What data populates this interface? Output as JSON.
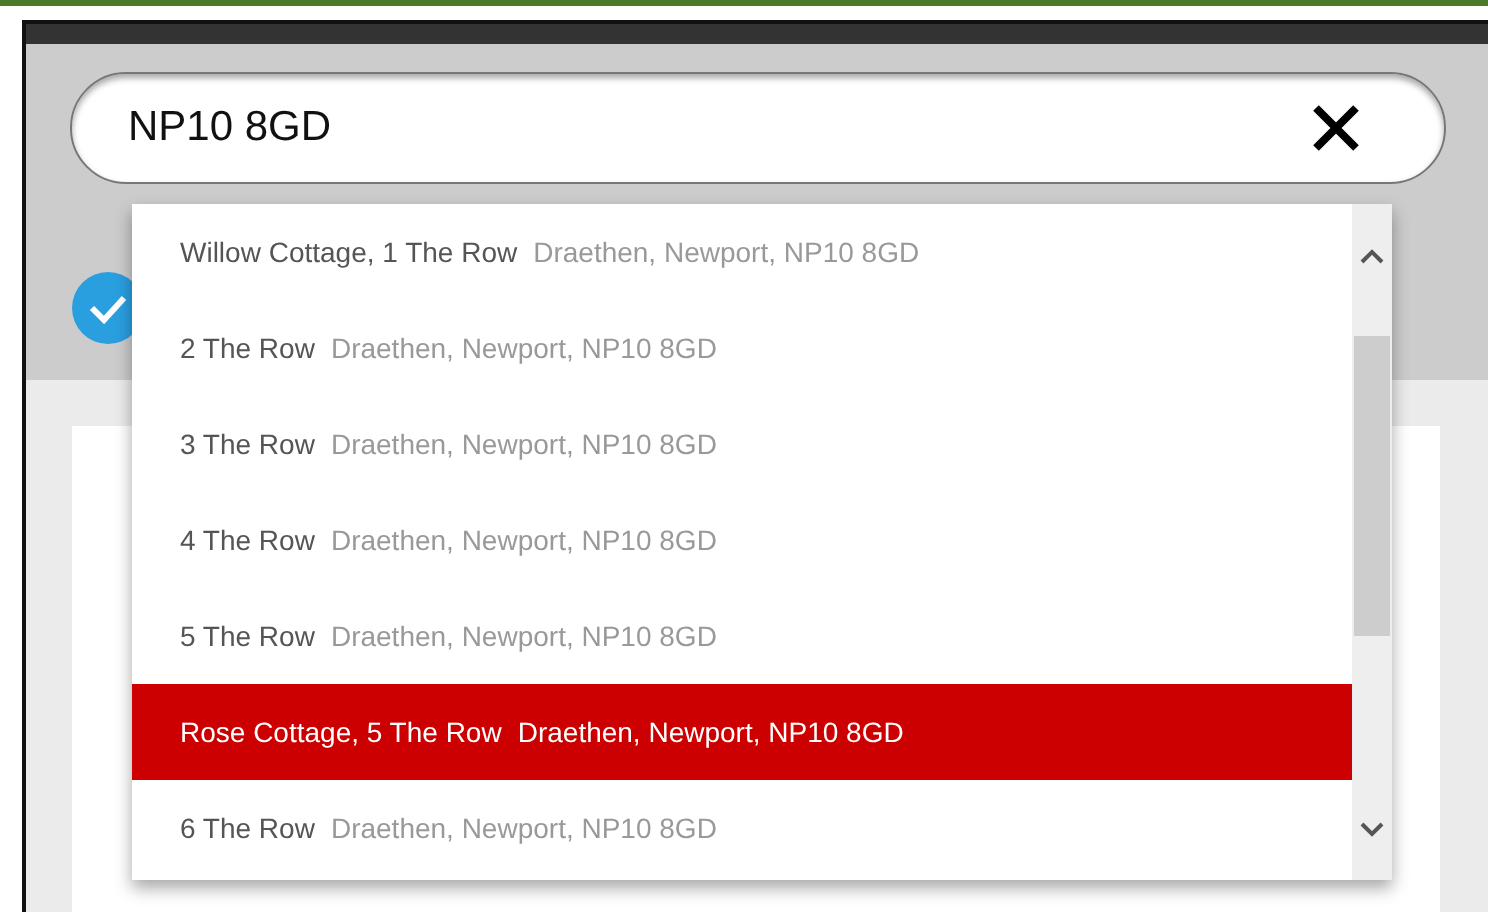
{
  "search": {
    "value": "NP10 8GD"
  },
  "suggestions": [
    {
      "address": "Willow Cottage, 1 The Row",
      "locality": "Draethen, Newport, NP10 8GD",
      "selected": false
    },
    {
      "address": "2 The Row",
      "locality": "Draethen, Newport, NP10 8GD",
      "selected": false
    },
    {
      "address": "3 The Row",
      "locality": "Draethen, Newport, NP10 8GD",
      "selected": false
    },
    {
      "address": "4 The Row",
      "locality": "Draethen, Newport, NP10 8GD",
      "selected": false
    },
    {
      "address": "5 The Row",
      "locality": "Draethen, Newport, NP10 8GD",
      "selected": false
    },
    {
      "address": "Rose Cottage, 5 The Row",
      "locality": "Draethen, Newport, NP10 8GD",
      "selected": true
    },
    {
      "address": "6 The Row",
      "locality": "Draethen, Newport, NP10 8GD",
      "selected": false
    }
  ]
}
